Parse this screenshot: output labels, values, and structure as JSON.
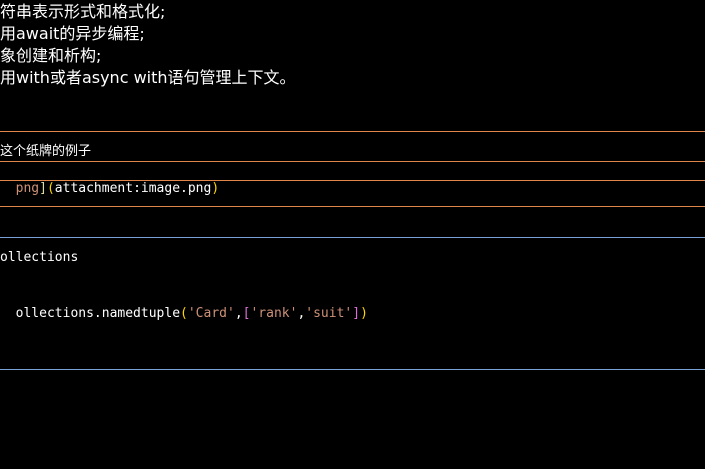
{
  "markdown": {
    "lines": [
      "符串表示形式和格式化;",
      "用await的异步编程;",
      "象创建和析构;",
      "用with或者async with语句管理上下文。"
    ],
    "caption": "这个纸牌的例子",
    "link": {
      "text_tail": "png",
      "close_bracket": "]",
      "open_paren": "(",
      "url": "attachment:image.png",
      "close_paren": ")"
    }
  },
  "code": {
    "line1": "ollections",
    "line2": {
      "prefix": "ollections.namedtuple",
      "open_paren": "(",
      "string1": "'Card'",
      "comma1": ",",
      "open_bracket": "[",
      "string2": "'rank'",
      "comma2": ",",
      "string3": "'suit'",
      "close_bracket": "]",
      "close_paren": ")"
    }
  },
  "colors": {
    "background": "#000000",
    "markdown_border": "#e0864a",
    "code_border": "#7aa2d6",
    "string": "#ce9178",
    "paren": "#ffd700",
    "bracket": "#da70d6"
  }
}
